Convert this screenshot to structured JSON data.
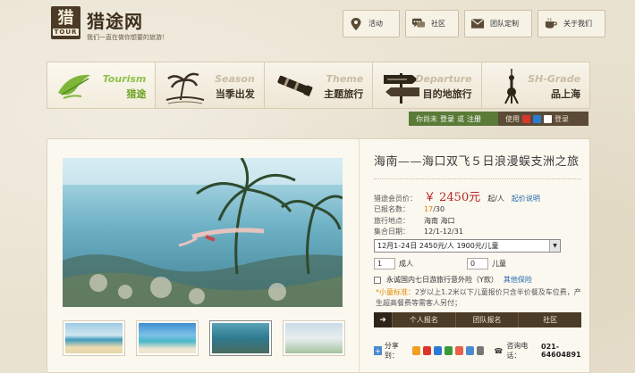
{
  "header": {
    "logo_glyph": "猎",
    "logo_tour": "TOUR",
    "site_name": "猎途网",
    "slogan": "我们一直在做你想要的旅游！",
    "nav": [
      {
        "label": "活动",
        "icon": "location-pin-icon"
      },
      {
        "label": "社区",
        "icon": "chat-bubble-icon"
      },
      {
        "label": "团队定制",
        "icon": "envelope-icon"
      },
      {
        "label": "关于我们",
        "icon": "coffee-cup-icon"
      }
    ]
  },
  "categories": [
    {
      "en": "Tourism",
      "cn": "猎途",
      "icon": "leaf-logo-icon",
      "active": true
    },
    {
      "en": "Season",
      "cn": "当季出发",
      "icon": "palm-island-icon",
      "active": false
    },
    {
      "en": "Theme",
      "cn": "主题旅行",
      "icon": "telescope-icon",
      "active": false
    },
    {
      "en": "Departure",
      "cn": "目的地旅行",
      "icon": "signpost-icon",
      "active": false
    },
    {
      "en": "SH-Grade",
      "cn": "品上海",
      "icon": "tv-tower-icon",
      "active": false
    }
  ],
  "login_bar": {
    "prefix": "你尚未",
    "login": "登录",
    "or": "或",
    "register": "注册"
  },
  "share_bar": {
    "prefix": "使用",
    "login": "登录"
  },
  "product": {
    "title": "海南——海口双飞５日浪漫蜈支洲之旅",
    "price_label": "猎途会员价：",
    "price": "￥ 2450元",
    "per": "起/人",
    "price_link": "起价说明",
    "info": [
      {
        "k": "已报名数：",
        "v_hi": "17",
        "v": "/30"
      },
      {
        "k": "旅行地点：",
        "v_hi": "",
        "v": "海南  海口"
      },
      {
        "k": "集合日期：",
        "v_hi": "",
        "v": "12/1-12/31"
      }
    ],
    "date_option": "12月1-24日  2450元/人  1900元/儿童",
    "adult_qty": "1",
    "adult_label": "成人",
    "child_qty": "0",
    "child_label": "儿童",
    "insurance": "永诚国内七日游旅行意外险（Y款）",
    "insurance_link": "其他保险",
    "note_prefix": "*小童标准：",
    "note_text": "2岁以上1.2米以下儿童报价只含半价餐及车位费，产生超高餐费等需客人另付；",
    "actions": [
      "个人报名",
      "团队报名",
      "社区"
    ],
    "share_label": "分享到：",
    "hotline_label": "咨询电话：",
    "hotline_number": "021-64604891"
  }
}
